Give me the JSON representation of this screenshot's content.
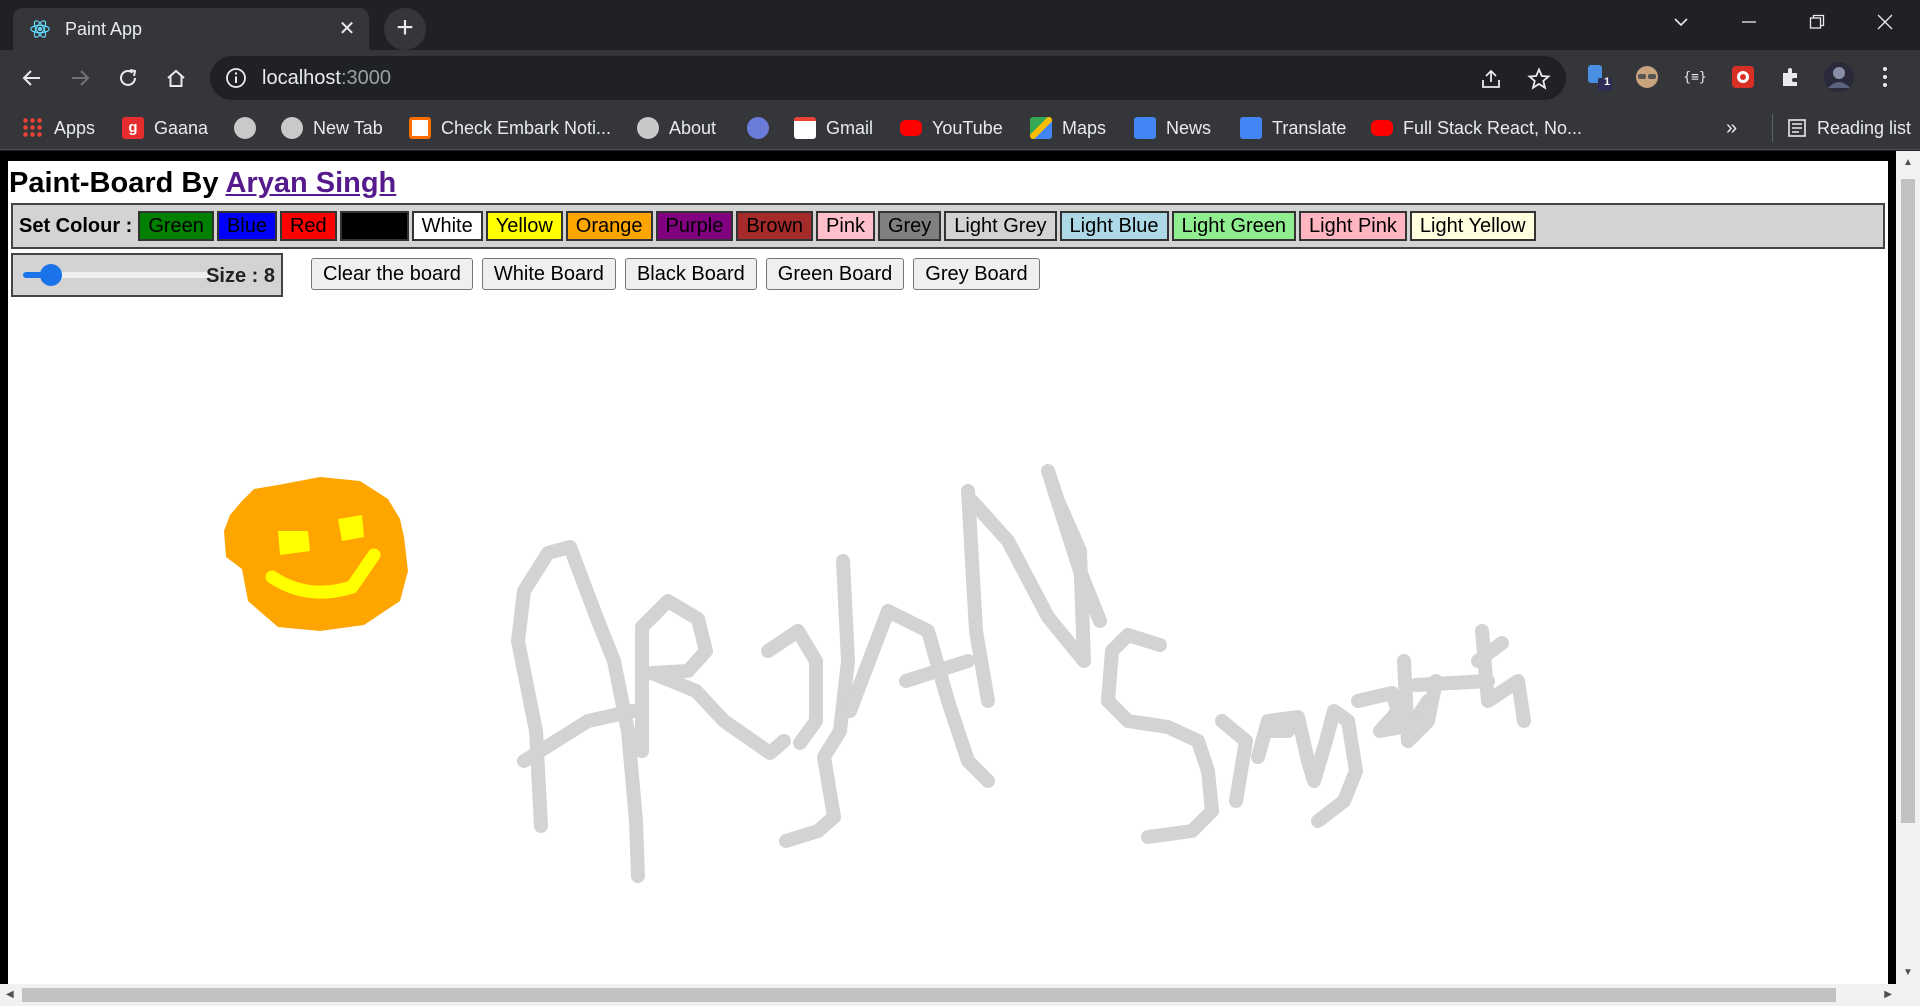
{
  "browser": {
    "tab_title": "Paint App",
    "url_host": "localhost",
    "url_port": ":3000",
    "extension_badge": "1",
    "extension_braces": "{≡}"
  },
  "bookmarks": [
    {
      "label": "Apps",
      "icon": "apps-grid-icon"
    },
    {
      "label": "Gaana",
      "icon": "gaana-icon"
    },
    {
      "label": "",
      "icon": "globe-icon"
    },
    {
      "label": "New Tab",
      "icon": "globe-icon"
    },
    {
      "label": "Check Embark Noti...",
      "icon": "embark-icon"
    },
    {
      "label": "About",
      "icon": "globe-icon"
    },
    {
      "label": "",
      "icon": "feather-icon"
    },
    {
      "label": "Gmail",
      "icon": "gmail-icon"
    },
    {
      "label": "YouTube",
      "icon": "youtube-icon"
    },
    {
      "label": "Maps",
      "icon": "maps-icon"
    },
    {
      "label": "News",
      "icon": "news-icon"
    },
    {
      "label": "Translate",
      "icon": "translate-icon"
    },
    {
      "label": "Full Stack React, No...",
      "icon": "youtube-icon"
    }
  ],
  "bookmarks_overflow": "»",
  "reading_list": "Reading list",
  "page": {
    "heading_prefix": "Paint-Board By",
    "author_link": "Aryan Singh",
    "set_colour_label": "Set Colour :",
    "colours": [
      {
        "label": "Green",
        "bg": "#008000",
        "fg": "#000000"
      },
      {
        "label": "Blue",
        "bg": "#0000ff",
        "fg": "#000000"
      },
      {
        "label": "Red",
        "bg": "#ff0000",
        "fg": "#000000"
      },
      {
        "label": "Black",
        "bg": "#000000",
        "fg": "#000000"
      },
      {
        "label": "White",
        "bg": "#ffffff",
        "fg": "#000000"
      },
      {
        "label": "Yellow",
        "bg": "#ffff00",
        "fg": "#000000"
      },
      {
        "label": "Orange",
        "bg": "#ffa500",
        "fg": "#000000"
      },
      {
        "label": "Purple",
        "bg": "#800080",
        "fg": "#000000"
      },
      {
        "label": "Brown",
        "bg": "#a52a2a",
        "fg": "#000000"
      },
      {
        "label": "Pink",
        "bg": "#ffc0cb",
        "fg": "#000000"
      },
      {
        "label": "Grey",
        "bg": "#808080",
        "fg": "#000000"
      },
      {
        "label": "Light Grey",
        "bg": "#d3d3d3",
        "fg": "#000000"
      },
      {
        "label": "Light Blue",
        "bg": "#add8e6",
        "fg": "#000000"
      },
      {
        "label": "Light Green",
        "bg": "#90ee90",
        "fg": "#000000"
      },
      {
        "label": "Light Pink",
        "bg": "#ffb6c1",
        "fg": "#000000"
      },
      {
        "label": "Light Yellow",
        "bg": "#ffffe0",
        "fg": "#000000"
      }
    ],
    "size_label": "Size : 8",
    "brush_size": 8,
    "board_buttons": [
      "Clear the board",
      "White Board",
      "Black Board",
      "Green Board",
      "Grey Board"
    ],
    "drawing_colors": {
      "face": "#ffa500",
      "features": "#ffff00",
      "text": "#d3d3d3"
    }
  }
}
